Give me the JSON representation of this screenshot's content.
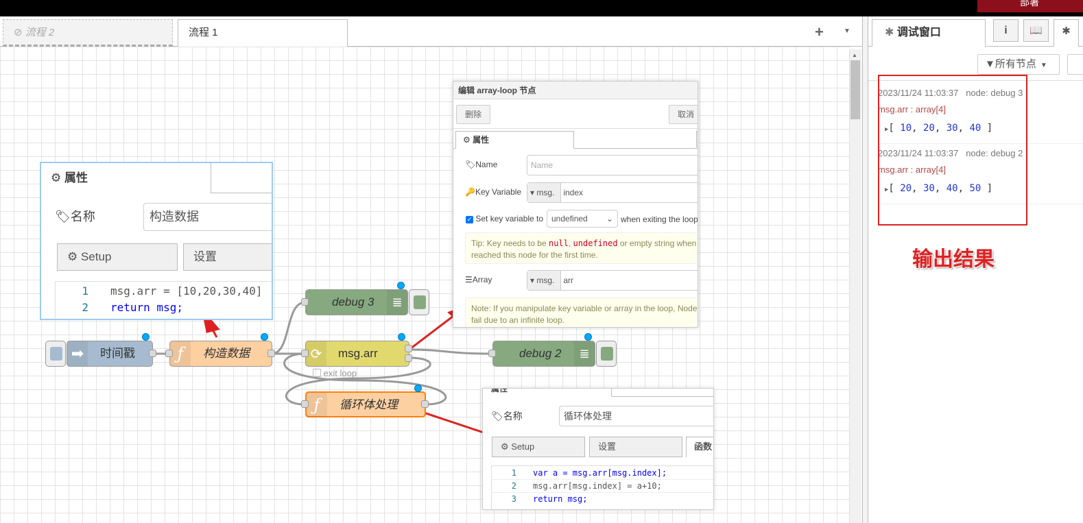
{
  "header": {
    "deploy_label": "部署"
  },
  "workspace": {
    "tabs": [
      {
        "label": "流程 2",
        "disabled": true
      },
      {
        "label": "流程 1",
        "active": true
      }
    ],
    "add_tab_symbol": "+",
    "menu_symbol": "▼"
  },
  "flow": {
    "nodes": {
      "inject": {
        "label": "时间戳",
        "type": "inject"
      },
      "func_build": {
        "label": "构造数据",
        "type": "function"
      },
      "debug3": {
        "label": "debug 3",
        "type": "debug"
      },
      "array_loop": {
        "label": "msg.arr",
        "type": "array-loop"
      },
      "debug2": {
        "label": "debug 2",
        "type": "debug"
      },
      "func_loop": {
        "label": "循环体处理",
        "type": "function"
      }
    },
    "exit_loop_label": "exit loop"
  },
  "panel_build": {
    "tab_label": "属性",
    "name_label": "名称",
    "name_value": "构造数据",
    "tabs": [
      "Setup",
      "设置"
    ],
    "code": [
      {
        "n": "1",
        "text": "msg.arr = [10,20,30,40]"
      },
      {
        "n": "2",
        "text": "return msg;"
      }
    ]
  },
  "panel_arrayloop": {
    "title": "编辑 array-loop 节点",
    "delete_label": "删除",
    "cancel_label": "取消",
    "tab_label": "属性",
    "name_label": "Name",
    "name_placeholder": "Name",
    "key_label": "Key Variable",
    "key_prefix": "msg.",
    "key_value": "index",
    "set_key_label": "Set key variable to",
    "set_key_select": "undefined",
    "set_key_suffix": "when exiting the loop",
    "tip_prefix": "Tip: Key needs to be ",
    "tip_null": "null",
    "tip_sep": ", ",
    "tip_undefined": "undefined",
    "tip_suffix": " or empty string when a msg",
    "tip_line2": "reached this node for the first time.",
    "array_label": "Array",
    "array_prefix": "msg.",
    "array_value": "arr",
    "note_line1": "Note: If you manipulate key variable or array in the loop, Node-RED",
    "note_line2": "fail due to an infinite loop."
  },
  "panel_loop": {
    "tab_label": "属性",
    "name_label": "名称",
    "name_value": "循环体处理",
    "tabs": [
      "Setup",
      "设置",
      "函数"
    ],
    "code": [
      {
        "n": "1",
        "text": "var a = msg.arr[msg.index];"
      },
      {
        "n": "2",
        "text": "msg.arr[msg.index] = a+10;"
      },
      {
        "n": "3",
        "text": "return msg;"
      }
    ]
  },
  "sidebar": {
    "active_tab": "调试窗口",
    "filter_label": "所有节点",
    "messages": [
      {
        "time": "2023/11/24 11:03:37",
        "node": "node: debug 3",
        "topic": "msg.arr : array[4]",
        "values": [
          "10",
          "20",
          "30",
          "40"
        ]
      },
      {
        "time": "2023/11/24 11:03:37",
        "node": "node: debug 2",
        "topic": "msg.arr : array[4]",
        "values": [
          "20",
          "30",
          "40",
          "50"
        ]
      }
    ],
    "annotation": "输出结果"
  },
  "colors": {
    "inject": "#a6bbcf",
    "function": "#fdd0a2",
    "debug": "#87a980",
    "array_loop": "#e2d96e",
    "annotation_red": "#e02020",
    "deploy": "#8c101c"
  }
}
